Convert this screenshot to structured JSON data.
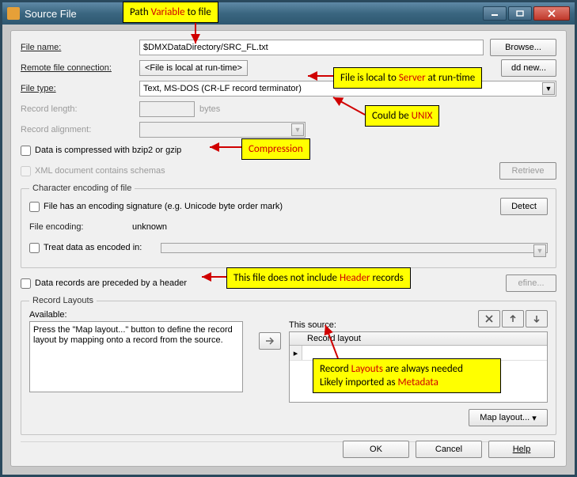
{
  "window": {
    "title": "Source File"
  },
  "fields": {
    "file_name_label": "File name:",
    "file_name_value": "$DMXDataDirectory/SRC_FL.txt",
    "browse": "Browse...",
    "remote_conn_label": "Remote file connection:",
    "remote_conn_value": "<File is local at run-time>",
    "add_new": "dd new...",
    "file_type_label": "File type:",
    "file_type_value": "Text, MS-DOS (CR-LF record terminator)",
    "rec_len_label": "Record length:",
    "rec_len_unit": "bytes",
    "rec_align_label": "Record alignment:",
    "compressed_label": "Data is compressed with bzip2 or gzip",
    "xml_schema_label": "XML document contains schemas",
    "retrieve": "Retrieve"
  },
  "encoding": {
    "legend": "Character encoding of file",
    "sig_label": "File has an encoding signature (e.g. Unicode byte order mark)",
    "detect": "Detect",
    "file_enc_label": "File encoding:",
    "file_enc_value": "unknown",
    "treat_label": "Treat data as encoded in:"
  },
  "header": {
    "label": "Data records are preceded by a header",
    "define": "efine..."
  },
  "layouts": {
    "legend": "Record Layouts",
    "available_label": "Available:",
    "available_text": "Press the \"Map layout...\" button to define the record layout by mapping onto a record from the source.",
    "this_source_label": "This source:",
    "column": "Record layout",
    "map_layout": "Map layout..."
  },
  "footer": {
    "ok": "OK",
    "cancel": "Cancel",
    "help": "Help"
  },
  "annotations": {
    "a1_pre": "Path ",
    "a1_red": "Variable",
    "a1_post": " to file",
    "a2_pre": "File is local to ",
    "a2_red": "Server",
    "a2_post": " at run-time",
    "a3_pre": "Could be ",
    "a3_red": "UNIX",
    "a4": "Compression",
    "a5_pre": "This file does not include ",
    "a5_red": "Header",
    "a5_post": " records",
    "a6_l1_pre": "Record ",
    "a6_l1_red": "Layouts",
    "a6_l1_post": " are always needed",
    "a6_l2_pre": "Likely imported as ",
    "a6_l2_red": "Metadata"
  }
}
